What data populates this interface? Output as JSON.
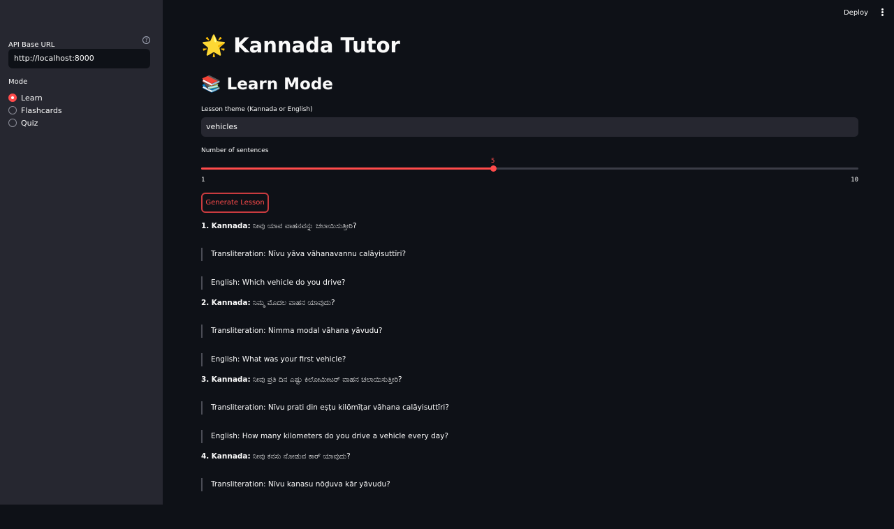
{
  "sidebar": {
    "api_label": "API Base URL",
    "api_value": "http://localhost:8000",
    "help_glyph": "?",
    "mode_label": "Mode",
    "modes": [
      {
        "label": "Learn",
        "selected": true
      },
      {
        "label": "Flashcards",
        "selected": false
      },
      {
        "label": "Quiz",
        "selected": false
      }
    ]
  },
  "topbar": {
    "deploy": "Deploy"
  },
  "main": {
    "title": "🌟 Kannada Tutor",
    "subtitle": "📚 Learn Mode",
    "theme_label": "Lesson theme (Kannada or English)",
    "theme_value": "vehicles",
    "sentences_label": "Number of sentences",
    "slider": {
      "value": 5,
      "min": 1,
      "max": 10,
      "min_label": "1",
      "max_label": "10",
      "value_label": "5"
    },
    "generate_button": "Generate Lesson"
  },
  "lesson": [
    {
      "num": "1.",
      "kannada_label": "Kannada:",
      "kannada": "ನೀವು ಯಾವ ವಾಹನವನ್ನು ಚಲಾಯಿಸುತ್ತೀರಿ?",
      "transliteration": "Transliteration: Nīvu yāva vāhanavannu calāyisuttīri?",
      "english": "English: Which vehicle do you drive?"
    },
    {
      "num": "2.",
      "kannada_label": "Kannada:",
      "kannada": "ನಿಮ್ಮ ಮೊದಲ ವಾಹನ ಯಾವುದು?",
      "transliteration": "Transliteration: Nimma modal vāhana yāvudu?",
      "english": "English: What was your first vehicle?"
    },
    {
      "num": "3.",
      "kannada_label": "Kannada:",
      "kannada": "ನೀವು ಪ್ರತಿ ದಿನ ಎಷ್ಟು ಕಿಲೋಮೀಟರ್ ವಾಹನ ಚಲಾಯಿಸುತ್ತೀರಿ?",
      "transliteration": "Transliteration: Nīvu prati din eṣṭu kilōmīṭar vāhana calāyisuttīri?",
      "english": "English: How many kilometers do you drive a vehicle every day?"
    },
    {
      "num": "4.",
      "kannada_label": "Kannada:",
      "kannada": "ನೀವು ಕನಸು ನೋಡುವ ಕಾರ್ ಯಾವುದು?",
      "transliteration": "Transliteration: Nīvu kanasu nōḍuva kār yāvudu?",
      "english": ""
    }
  ]
}
